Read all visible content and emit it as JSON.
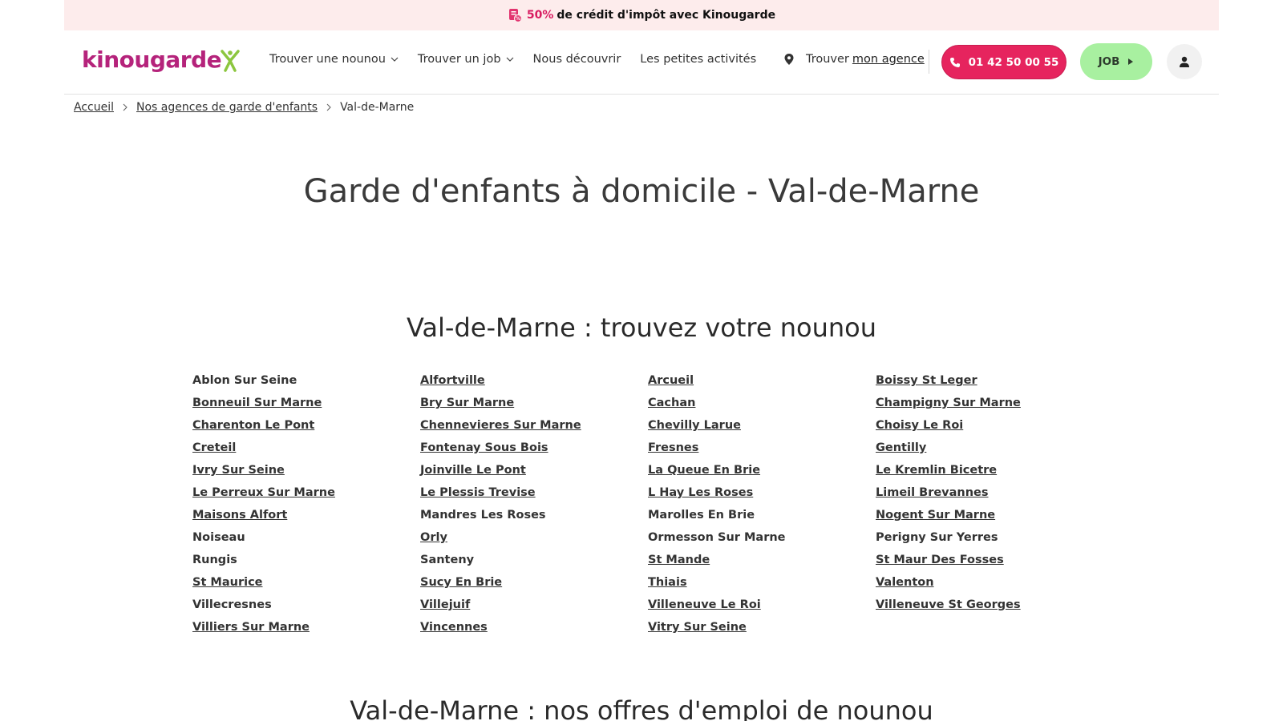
{
  "promo": {
    "percent": "50%",
    "text": "de crédit d'impôt avec Kinougarde",
    "icon": "tax-document-icon"
  },
  "header": {
    "logo_text": "kinougarde",
    "nav": [
      {
        "label": "Trouver une nounou",
        "dropdown": true
      },
      {
        "label": "Trouver un job",
        "dropdown": true
      },
      {
        "label": "Nous découvrir",
        "dropdown": false
      },
      {
        "label": "Les petites activités",
        "dropdown": false
      }
    ],
    "agency_prefix": "Trouver",
    "agency_link": "mon agence",
    "phone": "01 42 50 00 55",
    "job_label": "JOB",
    "colors": {
      "brand": "#b5237b",
      "phone_button": "#e6245e",
      "job_button": "#a8f0a0",
      "promo_bg": "#fdecec"
    }
  },
  "breadcrumb": {
    "items": [
      "Accueil",
      "Nos agences de garde d'enfants"
    ],
    "current": "Val-de-Marne"
  },
  "hero_title": "Garde d'enfants à domicile - Val-de-Marne",
  "section": {
    "title": "Val-de-Marne : trouvez votre nounou",
    "cities": [
      {
        "name": "Ablon Sur Seine",
        "link": false
      },
      {
        "name": "Alfortville",
        "link": true
      },
      {
        "name": "Arcueil",
        "link": true
      },
      {
        "name": "Boissy St Leger",
        "link": true
      },
      {
        "name": "Bonneuil Sur Marne",
        "link": true
      },
      {
        "name": "Bry Sur Marne",
        "link": true
      },
      {
        "name": "Cachan",
        "link": true
      },
      {
        "name": "Champigny Sur Marne",
        "link": true
      },
      {
        "name": "Charenton Le Pont",
        "link": true
      },
      {
        "name": "Chennevieres Sur Marne",
        "link": true
      },
      {
        "name": "Chevilly Larue",
        "link": true
      },
      {
        "name": "Choisy Le Roi",
        "link": true
      },
      {
        "name": "Creteil",
        "link": true
      },
      {
        "name": "Fontenay Sous Bois",
        "link": true
      },
      {
        "name": "Fresnes",
        "link": true
      },
      {
        "name": "Gentilly",
        "link": true
      },
      {
        "name": "Ivry Sur Seine",
        "link": true
      },
      {
        "name": "Joinville Le Pont",
        "link": true
      },
      {
        "name": "La Queue En Brie",
        "link": true
      },
      {
        "name": "Le Kremlin Bicetre",
        "link": true
      },
      {
        "name": "Le Perreux Sur Marne",
        "link": true
      },
      {
        "name": "Le Plessis Trevise",
        "link": true
      },
      {
        "name": "L Hay Les Roses",
        "link": true
      },
      {
        "name": "Limeil Brevannes",
        "link": true
      },
      {
        "name": "Maisons Alfort",
        "link": true
      },
      {
        "name": "Mandres Les Roses",
        "link": false
      },
      {
        "name": "Marolles En Brie",
        "link": false
      },
      {
        "name": "Nogent Sur Marne",
        "link": true
      },
      {
        "name": "Noiseau",
        "link": false
      },
      {
        "name": "Orly",
        "link": true
      },
      {
        "name": "Ormesson Sur Marne",
        "link": false
      },
      {
        "name": "Perigny Sur Yerres",
        "link": false
      },
      {
        "name": "Rungis",
        "link": false
      },
      {
        "name": "Santeny",
        "link": false
      },
      {
        "name": "St Mande",
        "link": true
      },
      {
        "name": "St Maur Des Fosses",
        "link": true
      },
      {
        "name": "St Maurice",
        "link": true
      },
      {
        "name": "Sucy En Brie",
        "link": true
      },
      {
        "name": "Thiais",
        "link": true
      },
      {
        "name": "Valenton",
        "link": true
      },
      {
        "name": "Villecresnes",
        "link": false
      },
      {
        "name": "Villejuif",
        "link": true
      },
      {
        "name": "Villeneuve Le Roi",
        "link": true
      },
      {
        "name": "Villeneuve St Georges",
        "link": true
      },
      {
        "name": "Villiers Sur Marne",
        "link": true
      },
      {
        "name": "Vincennes",
        "link": true
      },
      {
        "name": "Vitry Sur Seine",
        "link": true
      }
    ]
  },
  "section2_title": "Val-de-Marne : nos offres d'emploi de nounou"
}
